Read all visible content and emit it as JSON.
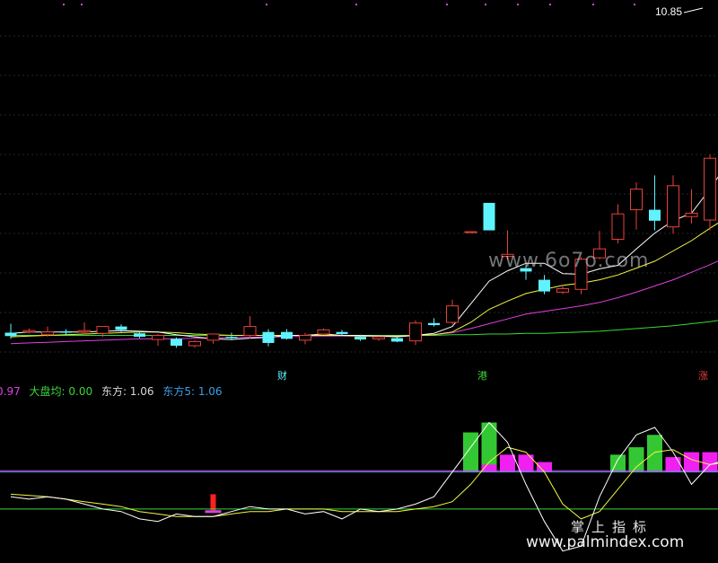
{
  "chart_data": [
    {
      "type": "candlestick",
      "title": "",
      "max_price_label": "10.85",
      "markers": [
        "财",
        "港",
        "涨"
      ],
      "colors": {
        "up": "#e8413a",
        "down": "#5ff3ff",
        "ma5": "#ffffff",
        "ma10": "#f5f543",
        "ma20": "#e040e0",
        "ma60": "#3ad83a"
      },
      "candles": [
        {
          "o": 6.21,
          "h": 6.34,
          "l": 6.12,
          "c": 6.16
        },
        {
          "o": 6.22,
          "h": 6.27,
          "l": 6.2,
          "c": 6.24
        },
        {
          "o": 6.18,
          "h": 6.3,
          "l": 6.15,
          "c": 6.22
        },
        {
          "o": 6.23,
          "h": 6.26,
          "l": 6.17,
          "c": 6.21
        },
        {
          "o": 6.22,
          "h": 6.36,
          "l": 6.18,
          "c": 6.24
        },
        {
          "o": 6.2,
          "h": 6.28,
          "l": 6.15,
          "c": 6.3
        },
        {
          "o": 6.3,
          "h": 6.33,
          "l": 6.22,
          "c": 6.25
        },
        {
          "o": 6.2,
          "h": 6.23,
          "l": 6.13,
          "c": 6.15
        },
        {
          "o": 6.11,
          "h": 6.19,
          "l": 6.02,
          "c": 6.17
        },
        {
          "o": 6.12,
          "h": 6.14,
          "l": 5.99,
          "c": 6.02
        },
        {
          "o": 6.02,
          "h": 6.1,
          "l": 5.99,
          "c": 6.08
        },
        {
          "o": 6.1,
          "h": 6.19,
          "l": 6.05,
          "c": 6.19
        },
        {
          "o": 6.15,
          "h": 6.21,
          "l": 6.1,
          "c": 6.13
        },
        {
          "o": 6.17,
          "h": 6.45,
          "l": 6.12,
          "c": 6.3
        },
        {
          "o": 6.22,
          "h": 6.26,
          "l": 6.01,
          "c": 6.06
        },
        {
          "o": 6.22,
          "h": 6.26,
          "l": 6.11,
          "c": 6.12
        },
        {
          "o": 6.1,
          "h": 6.21,
          "l": 6.04,
          "c": 6.17
        },
        {
          "o": 6.19,
          "h": 6.27,
          "l": 6.18,
          "c": 6.25
        },
        {
          "o": 6.22,
          "h": 6.25,
          "l": 6.17,
          "c": 6.19
        },
        {
          "o": 6.15,
          "h": 6.18,
          "l": 6.09,
          "c": 6.11
        },
        {
          "o": 6.12,
          "h": 6.16,
          "l": 6.09,
          "c": 6.15
        },
        {
          "o": 6.13,
          "h": 6.15,
          "l": 6.07,
          "c": 6.08
        },
        {
          "o": 6.09,
          "h": 6.39,
          "l": 6.03,
          "c": 6.35
        },
        {
          "o": 6.35,
          "h": 6.42,
          "l": 6.3,
          "c": 6.32
        },
        {
          "o": 6.36,
          "h": 6.69,
          "l": 6.33,
          "c": 6.6
        },
        {
          "o": 7.68,
          "h": 7.68,
          "l": 7.67,
          "c": 7.68
        },
        {
          "o": 8.1,
          "h": 8.1,
          "l": 7.7,
          "c": 7.7
        },
        {
          "o": 7.32,
          "h": 7.7,
          "l": 7.27,
          "c": 7.35
        },
        {
          "o": 7.15,
          "h": 7.19,
          "l": 6.98,
          "c": 7.1
        },
        {
          "o": 6.98,
          "h": 7.05,
          "l": 6.77,
          "c": 6.81
        },
        {
          "o": 6.8,
          "h": 6.91,
          "l": 6.77,
          "c": 6.85
        },
        {
          "o": 6.84,
          "h": 7.31,
          "l": 6.77,
          "c": 7.28
        },
        {
          "o": 7.3,
          "h": 7.69,
          "l": 7.28,
          "c": 7.43
        },
        {
          "o": 7.57,
          "h": 8.08,
          "l": 7.51,
          "c": 7.94
        },
        {
          "o": 8.0,
          "h": 8.4,
          "l": 7.71,
          "c": 8.3
        },
        {
          "o": 8.0,
          "h": 8.5,
          "l": 7.7,
          "c": 7.84
        },
        {
          "o": 7.75,
          "h": 8.5,
          "l": 7.65,
          "c": 8.35
        },
        {
          "o": 7.9,
          "h": 8.3,
          "l": 7.8,
          "c": 7.95
        },
        {
          "o": 7.85,
          "h": 8.8,
          "l": 7.7,
          "c": 8.75
        },
        {
          "o": 9.0,
          "h": 10.85,
          "l": 8.6,
          "c": 10.65
        }
      ],
      "ma5": [
        6.2,
        6.22,
        6.22,
        6.22,
        6.22,
        6.23,
        6.24,
        6.23,
        6.22,
        6.18,
        6.15,
        6.12,
        6.11,
        6.13,
        6.14,
        6.17,
        6.17,
        6.19,
        6.17,
        6.17,
        6.16,
        6.15,
        6.17,
        6.2,
        6.3,
        6.63,
        6.96,
        7.11,
        7.22,
        7.22,
        7.07,
        7.06,
        7.14,
        7.19,
        7.43,
        7.66,
        7.84,
        7.95,
        8.3,
        8.7
      ],
      "ma10": [
        6.15,
        6.16,
        6.17,
        6.18,
        6.19,
        6.2,
        6.21,
        6.22,
        6.22,
        6.21,
        6.19,
        6.18,
        6.17,
        6.17,
        6.17,
        6.17,
        6.17,
        6.17,
        6.17,
        6.16,
        6.16,
        6.16,
        6.17,
        6.18,
        6.22,
        6.36,
        6.55,
        6.67,
        6.78,
        6.84,
        6.9,
        6.93,
        6.98,
        7.05,
        7.15,
        7.25,
        7.4,
        7.55,
        7.73,
        7.9
      ],
      "ma20": [
        6.05,
        6.06,
        6.07,
        6.08,
        6.09,
        6.1,
        6.11,
        6.12,
        6.12,
        6.12,
        6.13,
        6.13,
        6.14,
        6.14,
        6.15,
        6.15,
        6.16,
        6.16,
        6.16,
        6.16,
        6.16,
        6.16,
        6.17,
        6.18,
        6.21,
        6.27,
        6.34,
        6.41,
        6.48,
        6.52,
        6.56,
        6.6,
        6.65,
        6.72,
        6.8,
        6.89,
        6.98,
        7.09,
        7.2,
        7.32
      ],
      "ma60": [
        6.17,
        6.17,
        6.17,
        6.17,
        6.17,
        6.17,
        6.17,
        6.17,
        6.17,
        6.17,
        6.17,
        6.17,
        6.17,
        6.17,
        6.17,
        6.17,
        6.17,
        6.17,
        6.17,
        6.17,
        6.17,
        6.17,
        6.17,
        6.17,
        6.18,
        6.18,
        6.19,
        6.19,
        6.2,
        6.2,
        6.21,
        6.22,
        6.23,
        6.25,
        6.27,
        6.29,
        6.31,
        6.34,
        6.37,
        6.41
      ]
    },
    {
      "type": "bar",
      "title": "",
      "legend": [
        {
          "text": "0.97",
          "color": "#e040e0"
        },
        {
          "text": "大盘均: 0.00",
          "color": "#3ad83a"
        },
        {
          "text": "东方: 1.06",
          "color": "#d8d8d8"
        },
        {
          "text": "东方5: 1.06",
          "color": "#3aa0e8"
        }
      ],
      "ylim": [
        -3.5,
        3.0
      ],
      "green_bars": [
        null,
        null,
        null,
        null,
        null,
        null,
        null,
        null,
        null,
        null,
        null,
        null,
        null,
        null,
        null,
        null,
        null,
        null,
        null,
        null,
        null,
        null,
        null,
        null,
        null,
        1.6,
        2.0,
        null,
        null,
        null,
        null,
        null,
        null,
        0.7,
        1.0,
        1.5,
        null,
        null,
        null,
        null
      ],
      "magenta_bars": [
        null,
        null,
        null,
        null,
        null,
        null,
        null,
        null,
        null,
        null,
        null,
        null,
        null,
        null,
        null,
        null,
        null,
        null,
        null,
        null,
        null,
        null,
        null,
        null,
        null,
        null,
        0.3,
        0.7,
        0.7,
        0.4,
        null,
        null,
        null,
        null,
        null,
        null,
        0.6,
        0.8,
        0.8,
        0.8
      ],
      "red_bars": [
        null,
        null,
        null,
        null,
        null,
        null,
        null,
        null,
        null,
        null,
        null,
        -0.9,
        null,
        null,
        null,
        null,
        null,
        null,
        null,
        null,
        null,
        null,
        null,
        null,
        null,
        null,
        null,
        null,
        null,
        null,
        null,
        null,
        null,
        null,
        null,
        null,
        null,
        null,
        null,
        null
      ],
      "line_white": [
        -1.0,
        -1.1,
        -1.0,
        -1.1,
        -1.3,
        -1.5,
        -1.6,
        -1.9,
        -2.0,
        -1.7,
        -1.8,
        -1.8,
        -1.6,
        -1.4,
        -1.5,
        -1.5,
        -1.7,
        -1.6,
        -1.9,
        -1.5,
        -1.6,
        -1.5,
        -1.3,
        -1.0,
        0.0,
        1.0,
        2.0,
        1.2,
        -0.5,
        -2.0,
        -3.2,
        -3.0,
        -1.0,
        0.5,
        1.5,
        1.8,
        0.8,
        -0.5,
        0.3,
        0.5
      ],
      "line_yellow": [
        -0.9,
        -0.95,
        -1.0,
        -1.1,
        -1.2,
        -1.3,
        -1.4,
        -1.6,
        -1.7,
        -1.8,
        -1.8,
        -1.8,
        -1.7,
        -1.6,
        -1.6,
        -1.5,
        -1.5,
        -1.5,
        -1.6,
        -1.6,
        -1.6,
        -1.6,
        -1.5,
        -1.4,
        -1.2,
        -0.5,
        0.4,
        1.0,
        0.8,
        0.0,
        -1.3,
        -1.9,
        -1.6,
        -0.7,
        0.2,
        0.8,
        0.9,
        0.5,
        0.3,
        0.4
      ],
      "line_magenta": 0.05,
      "line_blue": 0.0,
      "line_green": -1.5
    }
  ],
  "watermarks": {
    "mid": "www.6o7o.com",
    "cn": "掌上指标",
    "url": "www.palmindex.com"
  }
}
